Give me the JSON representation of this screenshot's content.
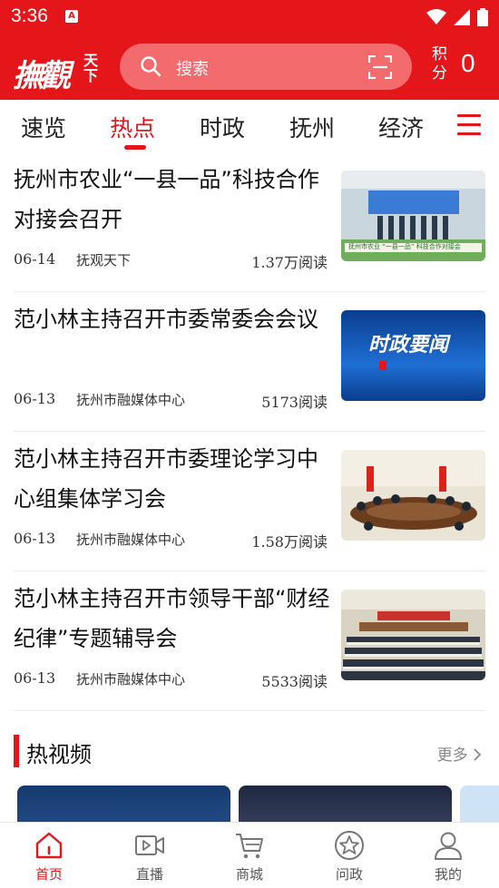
{
  "status_bar": {
    "time": "3:36",
    "app_badge": "A"
  },
  "header": {
    "logo_main": "撫觀",
    "logo_side": "天下",
    "search_placeholder": "搜索",
    "points_label": "积分",
    "points_value": "0"
  },
  "tabs": [
    {
      "label": "速览"
    },
    {
      "label": "热点"
    },
    {
      "label": "时政"
    },
    {
      "label": "抚州"
    },
    {
      "label": "经济"
    }
  ],
  "articles": [
    {
      "title": "抚州市农业“一县一品”科技合作对接会召开",
      "date": "06-14",
      "source": "抚观天下",
      "reads": "1.37万阅读",
      "thumb_caption": "抚州市农业 “一县一品” 科技合作对接会"
    },
    {
      "title": "范小林主持召开市委常委会会议",
      "date": "06-13",
      "source": "抚州市融媒体中心",
      "reads": "5173阅读",
      "thumb_caption": "时政要闻"
    },
    {
      "title": "范小林主持召开市委理论学习中心组集体学习会",
      "date": "06-13",
      "source": "抚州市融媒体中心",
      "reads": "1.58万阅读",
      "thumb_caption": ""
    },
    {
      "title": "范小林主持召开市领导干部“财经纪律”专题辅导会",
      "date": "06-13",
      "source": "抚州市融媒体中心",
      "reads": "5533阅读",
      "thumb_caption": ""
    }
  ],
  "hot_video": {
    "title": "热视频",
    "more": "更多"
  },
  "bottom_nav": [
    {
      "label": "首页",
      "icon": "home-icon"
    },
    {
      "label": "直播",
      "icon": "live-icon"
    },
    {
      "label": "商城",
      "icon": "cart-icon"
    },
    {
      "label": "问政",
      "icon": "star-icon"
    },
    {
      "label": "我的",
      "icon": "user-icon"
    }
  ],
  "colors": {
    "brand": "#e5161a",
    "search_bg": "#f46b6d"
  }
}
